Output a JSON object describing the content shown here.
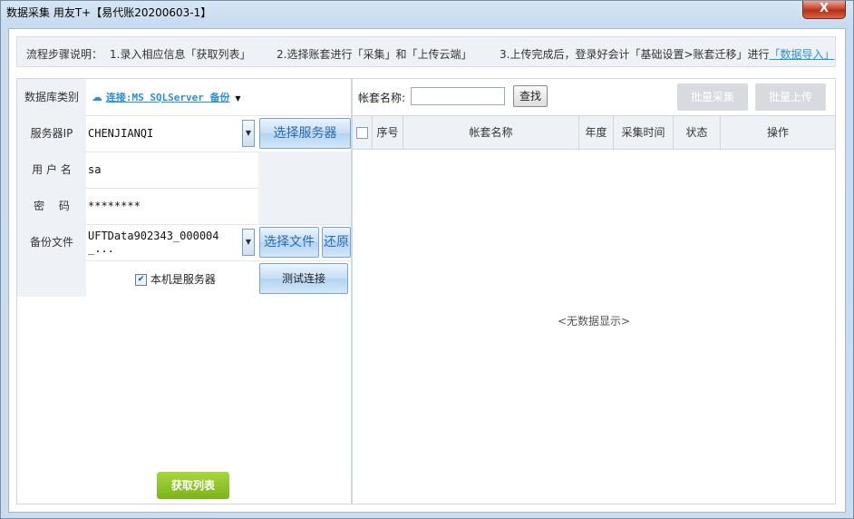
{
  "window": {
    "title": "数据采集 用友T+【易代账20200603-1】",
    "close_label": "X"
  },
  "steps": {
    "prefix": "流程步骤说明：",
    "step1": "1.录入相应信息「获取列表」",
    "step2": "2.选择账套进行「采集」和「上传云端」",
    "step3": "3.上传完成后，登录好会计「基础设置>账套迁移」进行",
    "step3_link": "「数据导入」"
  },
  "form": {
    "db_type_label": "数据库类别",
    "db_type_value": "连接:MS SQLServer 备份",
    "server_ip_label": "服务器IP",
    "server_ip_value": "CHENJIANQI",
    "select_server_button": "选择服务器",
    "username_label": "用 户 名",
    "username_value": "sa",
    "password_label": "密　 码",
    "password_value": "********",
    "backup_file_label": "备份文件",
    "backup_file_value": "UFTData902343_000004_...",
    "select_file_button": "选择文件",
    "restore_button": "还原",
    "local_server_label": "本机是服务器",
    "test_connection_button": "测试连接",
    "get_list_button": "获取列表"
  },
  "accounts": {
    "search_label": "帐套名称:",
    "search_value": "",
    "find_button": "查找",
    "batch_collect_button": "批量采集",
    "batch_upload_button": "批量上传",
    "columns": [
      "序号",
      "帐套名称",
      "年度",
      "采集时间",
      "状态",
      "操作"
    ],
    "empty_text": "<无数据显示>"
  }
}
